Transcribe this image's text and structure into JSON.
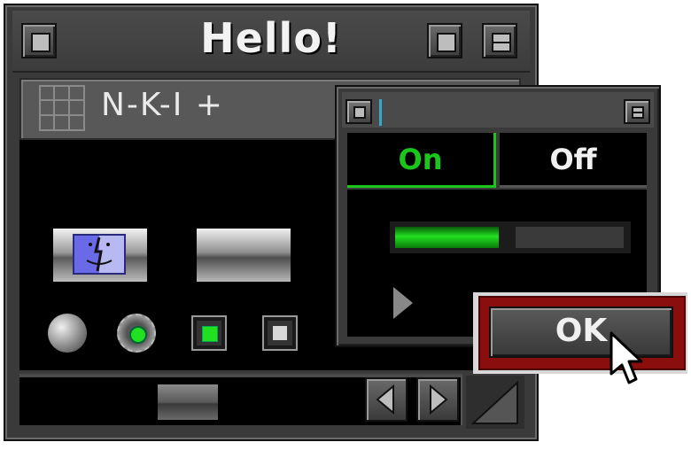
{
  "window": {
    "title": "Hello!",
    "toolbar_text": "N-K-I +"
  },
  "secondary": {
    "segment_on": "On",
    "segment_off": "Off",
    "slider_value_fraction": 0.45
  },
  "dialog": {
    "ok_label": "OK"
  },
  "controls": {
    "radio_selected": true,
    "checkbox_1_checked": true,
    "checkbox_2_checked": false
  },
  "icons": [
    "close-box-icon",
    "zoom-box-icon",
    "collapse-box-icon",
    "grid-icon",
    "finder-icon",
    "left-arrow-icon",
    "right-arrow-icon",
    "grow-box-icon",
    "disclosure-triangle-icon",
    "mouse-pointer-icon"
  ],
  "colors": {
    "accent_green": "#22e022",
    "default_button_ring": "#8a0e0e",
    "finder_blue": "#6a6ae8"
  }
}
